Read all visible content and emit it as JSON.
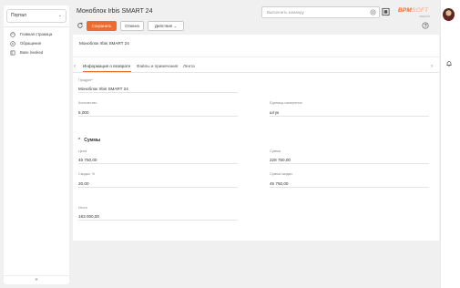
{
  "sidebar": {
    "portal_select": "Портал",
    "items": [
      {
        "label": "Главная страница",
        "icon": "home-icon"
      },
      {
        "label": "Обращения",
        "icon": "request-icon"
      },
      {
        "label": "Base invoked",
        "icon": "book-icon"
      }
    ],
    "collapse": "«"
  },
  "header": {
    "title": "Моноблок Irbis SMART 24",
    "search_placeholder": "Выполнить команду",
    "logo_main": "BPM",
    "logo_soft": "SOFT",
    "logo_sub": "CREATIO"
  },
  "toolbar": {
    "save_label": "Сохранить",
    "cancel_label": "Отмена",
    "actions_label": "Действия",
    "actions_chevron": "⌄"
  },
  "record": {
    "name": "Моноблок Irbis SMART 24"
  },
  "tabs": {
    "items": [
      {
        "label": "Информация о возврате"
      },
      {
        "label": "Файлы и примечания"
      },
      {
        "label": "Лента"
      }
    ],
    "prev": "‹",
    "next": "›"
  },
  "fields": {
    "product": {
      "label": "Продукт*",
      "value": "Моноблок Irbis SMART 24"
    },
    "quantity": {
      "label": "Количество",
      "value": "5,000"
    },
    "unit": {
      "label": "Единица измерения",
      "value": "штук"
    }
  },
  "sums": {
    "title": "Суммы",
    "chevron": "⌃",
    "price": {
      "label": "Цена",
      "value": "45 750,00"
    },
    "amount": {
      "label": "Сумма",
      "value": "228 750,00"
    },
    "discount_pct": {
      "label": "Скидка, %",
      "value": "20,00"
    },
    "discount_amount": {
      "label": "Сумма скидки",
      "value": "45 750,00"
    },
    "total": {
      "label": "Итого",
      "value": "183 000,00"
    }
  },
  "colors": {
    "accent": "#ee6b2d",
    "logo": "#f06a24"
  }
}
